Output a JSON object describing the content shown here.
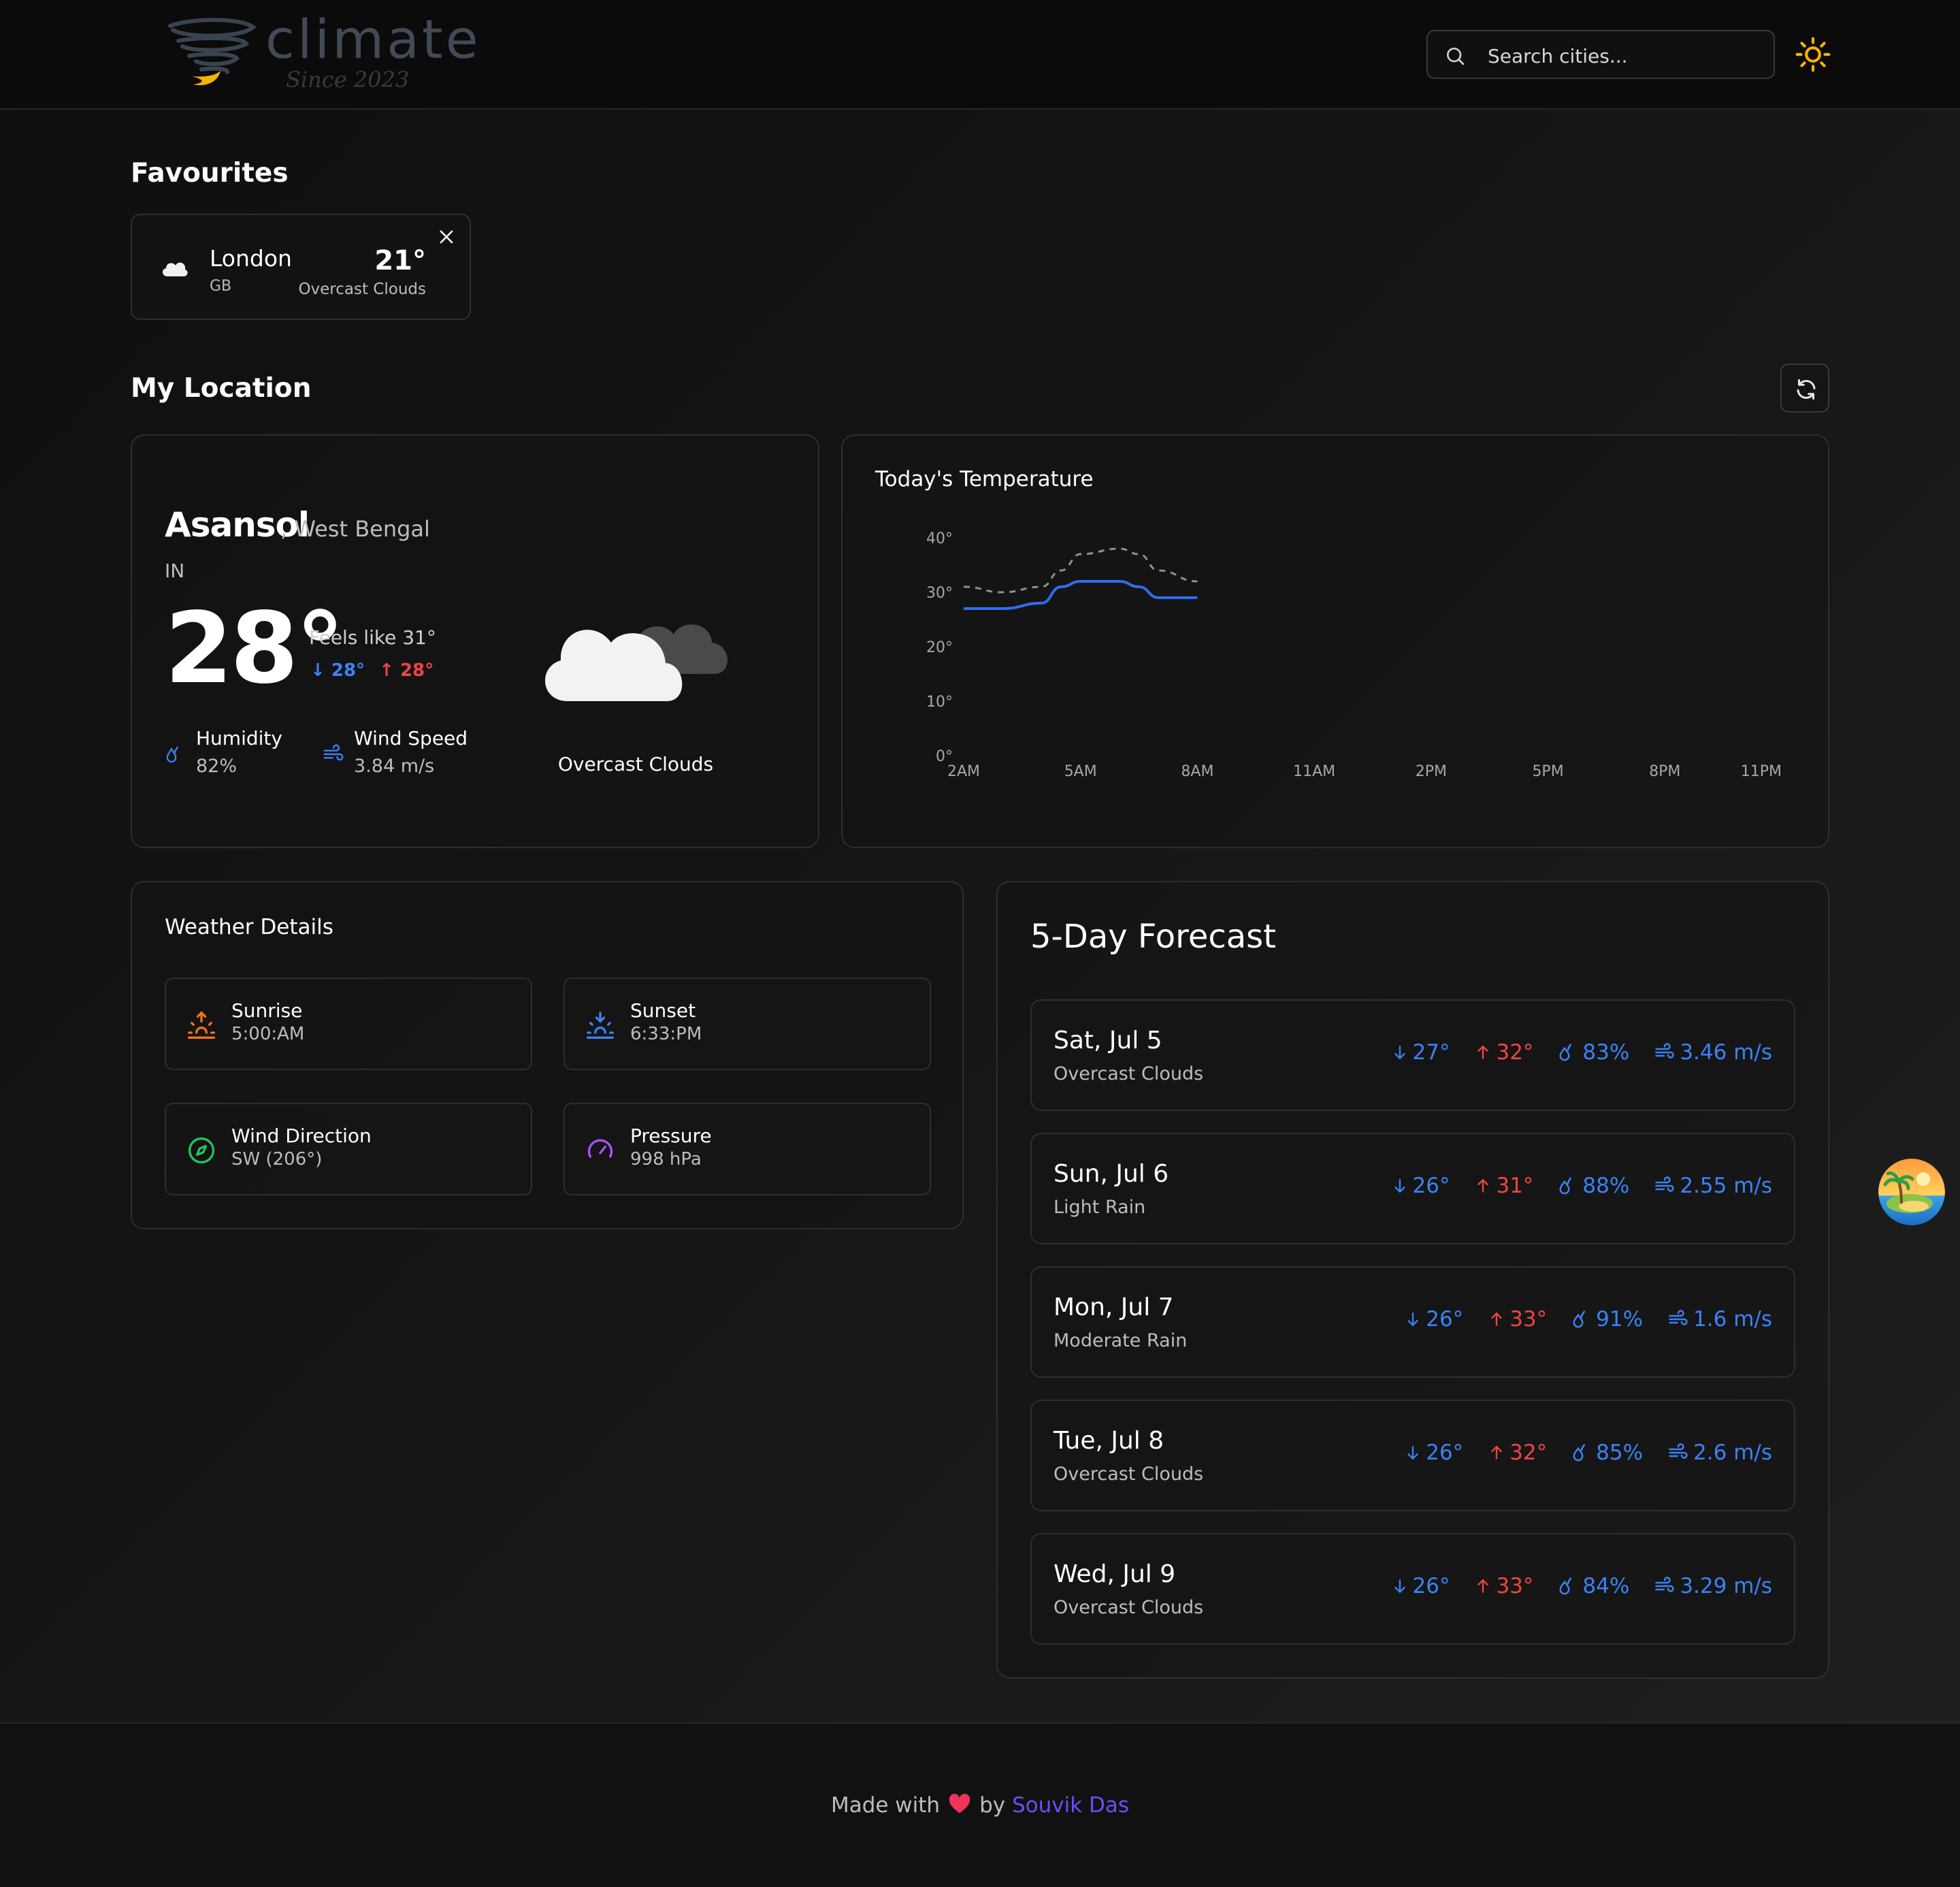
{
  "brand": {
    "name": "climate",
    "tagline": "Since 2023"
  },
  "search": {
    "placeholder": "Search cities..."
  },
  "favourites": {
    "title": "Favourites",
    "items": [
      {
        "city": "London",
        "country": "GB",
        "temp": "21°",
        "description": "Overcast Clouds"
      }
    ]
  },
  "my_location": {
    "title": "My Location",
    "city": "Asansol",
    "region": ", West Bengal",
    "country": "IN",
    "temp": "28°",
    "feels_like": "Feels like 31°",
    "min": "28°",
    "max": "28°",
    "humidity_label": "Humidity",
    "humidity": "82%",
    "wind_label": "Wind Speed",
    "wind": "3.84 m/s",
    "condition": "Overcast Clouds"
  },
  "chart_data": {
    "type": "line",
    "title": "Today's Temperature",
    "x_ticks": [
      "2AM",
      "5AM",
      "8AM",
      "11AM",
      "2PM",
      "5PM",
      "8PM",
      "11PM"
    ],
    "y_ticks": [
      "0°",
      "10°",
      "20°",
      "30°",
      "40°"
    ],
    "ylim": [
      0,
      40
    ],
    "grid": false,
    "series": [
      {
        "style": "solid",
        "color": "#2f6df6",
        "x_hours": [
          2,
          3,
          4,
          4.5,
          5,
          6,
          6.5,
          7,
          8
        ],
        "values": [
          27,
          27,
          28,
          31,
          32,
          32,
          31,
          29,
          29
        ]
      },
      {
        "style": "dashed",
        "color": "#8a8f98",
        "x_hours": [
          2,
          3,
          4,
          4.5,
          5,
          6,
          6.5,
          7,
          8
        ],
        "values": [
          31,
          30,
          31,
          34,
          37,
          38,
          37,
          34,
          32
        ]
      }
    ]
  },
  "details": {
    "title": "Weather Details",
    "items": [
      {
        "label": "Sunrise",
        "value": "5:00:AM",
        "icon": "sunrise-icon",
        "color": "#f97316"
      },
      {
        "label": "Sunset",
        "value": "6:33:PM",
        "icon": "sunset-icon",
        "color": "#3b82f6"
      },
      {
        "label": "Wind Direction",
        "value": "SW (206°)",
        "icon": "compass-icon",
        "color": "#22c55e"
      },
      {
        "label": "Pressure",
        "value": "998 hPa",
        "icon": "gauge-icon",
        "color": "#a855f7"
      }
    ]
  },
  "forecast": {
    "title": "5-Day Forecast",
    "days": [
      {
        "day": "Sat, Jul 5",
        "cond": "Overcast Clouds",
        "min": "27°",
        "max": "32°",
        "humidity": "83%",
        "wind": "3.46 m/s"
      },
      {
        "day": "Sun, Jul 6",
        "cond": "Light Rain",
        "min": "26°",
        "max": "31°",
        "humidity": "88%",
        "wind": "2.55 m/s"
      },
      {
        "day": "Mon, Jul 7",
        "cond": "Moderate Rain",
        "min": "26°",
        "max": "33°",
        "humidity": "91%",
        "wind": "1.6 m/s"
      },
      {
        "day": "Tue, Jul 8",
        "cond": "Overcast Clouds",
        "min": "26°",
        "max": "32°",
        "humidity": "85%",
        "wind": "2.6 m/s"
      },
      {
        "day": "Wed, Jul 9",
        "cond": "Overcast Clouds",
        "min": "26°",
        "max": "33°",
        "humidity": "84%",
        "wind": "3.29 m/s"
      }
    ]
  },
  "footer": {
    "made_with": "Made with",
    "by": "by",
    "author": "Souvik Das"
  },
  "colors": {
    "accent": "#3b82f6",
    "max_temp": "#ef4444",
    "theme_icon": "#f5b400",
    "author_link": "#6d4cff"
  }
}
